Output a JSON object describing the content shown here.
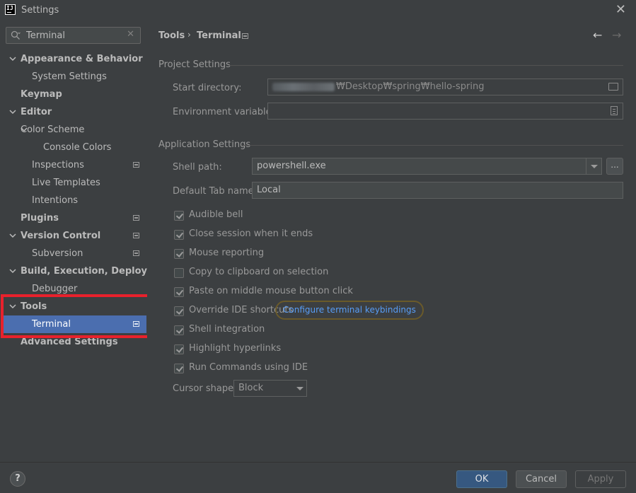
{
  "window": {
    "title": "Settings",
    "close": "✕"
  },
  "search": {
    "value": "Terminal",
    "clear": "✕"
  },
  "tree": [
    {
      "label": "Appearance & Behavior",
      "bold": true,
      "expanded": true,
      "indent": 0
    },
    {
      "label": "System Settings",
      "bold": false,
      "indent": 2
    },
    {
      "label": "Keymap",
      "bold": true,
      "indent": 1
    },
    {
      "label": "Editor",
      "bold": true,
      "expanded": true,
      "indent": 0
    },
    {
      "label": "Color Scheme",
      "bold": false,
      "expanded": true,
      "indent": 1
    },
    {
      "label": "Console Colors",
      "bold": false,
      "indent": 3
    },
    {
      "label": "Inspections",
      "bold": false,
      "indent": 2,
      "project": true
    },
    {
      "label": "Live Templates",
      "bold": false,
      "indent": 2
    },
    {
      "label": "Intentions",
      "bold": false,
      "indent": 2
    },
    {
      "label": "Plugins",
      "bold": true,
      "indent": 1,
      "project": true
    },
    {
      "label": "Version Control",
      "bold": true,
      "expanded": true,
      "indent": 0,
      "project": true
    },
    {
      "label": "Subversion",
      "bold": false,
      "indent": 2,
      "project": true
    },
    {
      "label": "Build, Execution, Deployment",
      "bold": true,
      "expanded": true,
      "indent": 0
    },
    {
      "label": "Debugger",
      "bold": false,
      "indent": 2
    },
    {
      "label": "Tools",
      "bold": true,
      "expanded": true,
      "indent": 0
    },
    {
      "label": "Terminal",
      "bold": false,
      "indent": 2,
      "project": true,
      "selected": true
    },
    {
      "label": "Advanced Settings",
      "bold": true,
      "indent": 1
    }
  ],
  "breadcrumb": {
    "parent": "Tools",
    "separator": "›",
    "current": "Terminal"
  },
  "nav": {
    "back": "←",
    "forward": "→"
  },
  "project_settings": {
    "title": "Project Settings",
    "start_directory_label": "Start directory:",
    "start_directory_value": "₩Desktop₩spring₩hello-spring",
    "env_vars_label": "Environment variables:",
    "env_vars_value": ""
  },
  "app_settings": {
    "title": "Application Settings",
    "shell_path_label": "Shell path:",
    "shell_path_value": "powershell.exe",
    "browse": "...",
    "tab_name_label": "Default Tab name:",
    "tab_name_value": "Local",
    "checkboxes": [
      {
        "label": "Audible bell",
        "checked": true
      },
      {
        "label": "Close session when it ends",
        "checked": true
      },
      {
        "label": "Mouse reporting",
        "checked": true
      },
      {
        "label": "Copy to clipboard on selection",
        "checked": false
      },
      {
        "label": "Paste on middle mouse button click",
        "checked": true
      },
      {
        "label": "Override IDE shortcuts",
        "checked": true
      },
      {
        "label": "Shell integration",
        "checked": true
      },
      {
        "label": "Highlight hyperlinks",
        "checked": true
      },
      {
        "label": "Run Commands using IDE",
        "checked": true
      }
    ],
    "configure_link": "Configure terminal keybindings",
    "cursor_shape_label": "Cursor shape:",
    "cursor_shape_value": "Block"
  },
  "footer": {
    "help": "?",
    "ok": "OK",
    "cancel": "Cancel",
    "apply": "Apply"
  },
  "colors": {
    "selection": "#4b6eaf",
    "highlight": "#e8212c",
    "link": "#589df6",
    "ok_button": "#365880"
  }
}
